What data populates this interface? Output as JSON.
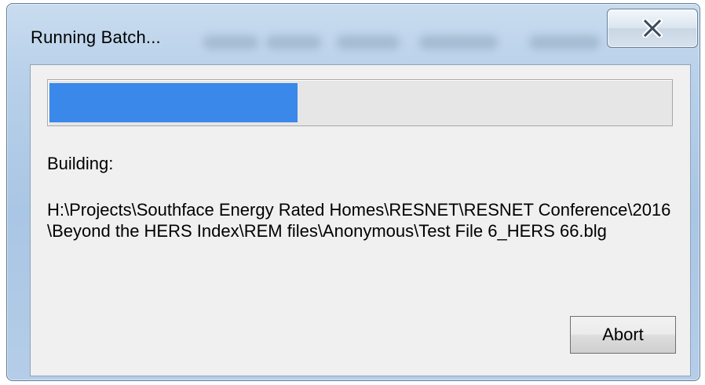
{
  "window": {
    "title": "Running Batch..."
  },
  "titlebar": {
    "close_icon": "close-icon"
  },
  "progress": {
    "fraction": 0.4,
    "fill_color": "#3a88ea"
  },
  "status": {
    "label": "Building:",
    "path": "H:\\Projects\\Southface Energy Rated Homes\\RESNET\\RESNET Conference\\2016\\Beyond the HERS Index\\REM files\\Anonymous\\Test File 6_HERS 66.blg"
  },
  "buttons": {
    "abort_label": "Abort"
  }
}
